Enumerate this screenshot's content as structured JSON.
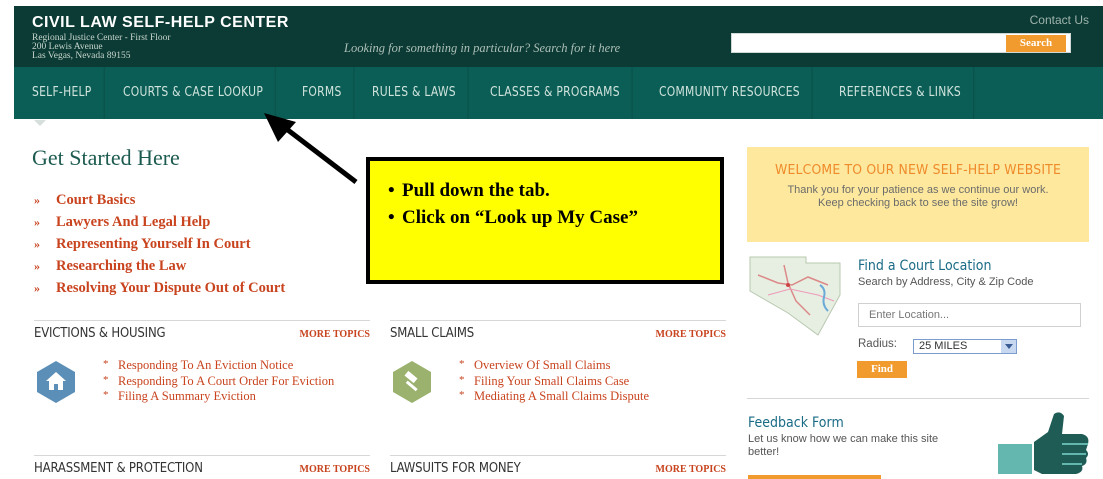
{
  "header": {
    "title": "CIVIL LAW SELF-HELP CENTER",
    "address_lines": [
      "Regional Justice Center - First Floor",
      "200 Lewis Avenue",
      "Las Vegas, Nevada 89155"
    ],
    "contact_label": "Contact Us",
    "search_prompt": "Looking for something in particular? Search for it here",
    "search_value": "",
    "search_button": "Search"
  },
  "nav": {
    "items": [
      "SELF-HELP",
      "COURTS & CASE LOOKUP",
      "FORMS",
      "RULES & LAWS",
      "CLASSES & PROGRAMS",
      "COMMUNITY RESOURCES",
      "REFERENCES & LINKS"
    ]
  },
  "get_started": {
    "title": "Get Started Here",
    "bullet": "»",
    "items": [
      "Court Basics",
      "Lawyers And Legal Help",
      "Representing Yourself In Court",
      "Researching the Law",
      "Resolving Your Dispute Out of Court"
    ]
  },
  "callout": {
    "items": [
      "Pull down the tab.",
      "Click on “Look up My Case”"
    ]
  },
  "topics": {
    "more_label": "MORE TOPICS",
    "star": "*",
    "evictions": {
      "title": "EVICTIONS & HOUSING",
      "links": [
        "Responding To An Eviction Notice",
        "Responding To A Court Order For Eviction",
        "Filing A Summary Eviction"
      ]
    },
    "small_claims": {
      "title": "SMALL CLAIMS",
      "links": [
        "Overview Of Small Claims",
        "Filing Your Small Claims Case",
        "Mediating A Small Claims Dispute"
      ]
    },
    "harassment": {
      "title": "HARASSMENT & PROTECTION"
    },
    "lawsuits": {
      "title": "LAWSUITS FOR MONEY"
    }
  },
  "sidebar": {
    "welcome": {
      "title": "WELCOME TO OUR NEW SELF-HELP WEBSITE",
      "body": "Thank you for your patience as we continue our work. Keep checking back to see the site grow!"
    },
    "find_court": {
      "title": "Find a Court Location",
      "subtitle": "Search by Address, City & Zip Code",
      "location_placeholder": "Enter Location...",
      "radius_label": "Radius:",
      "radius_value": "25 MILES",
      "find_button": "Find"
    },
    "feedback": {
      "title": "Feedback Form",
      "body": "Let us know how we can make this site better!"
    }
  },
  "colors": {
    "header_bg": "#0b3b34",
    "nav_bg": "#0b5e55",
    "accent_orange": "#f19b2e",
    "link_red": "#c8431e",
    "callout_yellow": "#ffff00"
  }
}
